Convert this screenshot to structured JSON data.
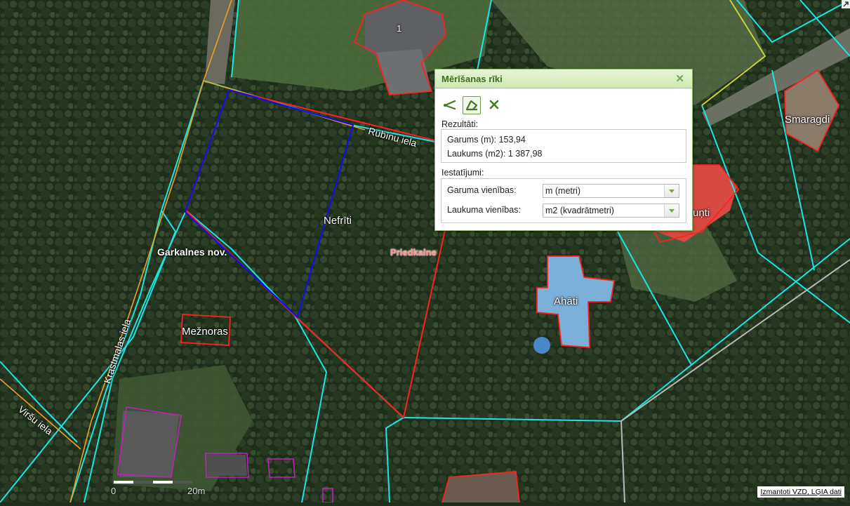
{
  "map": {
    "labels": {
      "house_number": "1",
      "smaragdi": "Smaragdi",
      "unti": "uņti",
      "nefriti": "Nefrīti",
      "priedkalne": "Priedkalne",
      "garkalnes": "Garkalnes nov.",
      "ahati": "Ahāti",
      "meznoras": "Mežnoras"
    },
    "streets": {
      "rubinu": "Rubīnu iela",
      "krastmalas": "Krastmalas iela",
      "virsu": "Viršu iela"
    },
    "scale": {
      "zero": "0",
      "distance": "20m"
    },
    "attribution": "Izmantoti VZD, LĢIA dati"
  },
  "panel": {
    "title": "Mērīšanas rīki",
    "close_icon": "close-icon",
    "tools": [
      "measure-length-icon",
      "measure-area-icon",
      "clear-icon"
    ],
    "results_label": "Rezultāti:",
    "length_text": "Garums (m): 153,94",
    "area_text": "Laukums (m2): 1 387,98",
    "settings_label": "Iestatījumi:",
    "length_units_label": "Garuma vienības:",
    "length_units_value": "m (metri)",
    "area_units_label": "Laukuma vienības:",
    "area_units_value": "m2 (kvadrātmetri)"
  },
  "colors": {
    "accent": "#4a7f22",
    "parcel_boundary": "#19e6e6",
    "measurement_line": "#1010e0",
    "selected_parcel": "#ff2020"
  }
}
